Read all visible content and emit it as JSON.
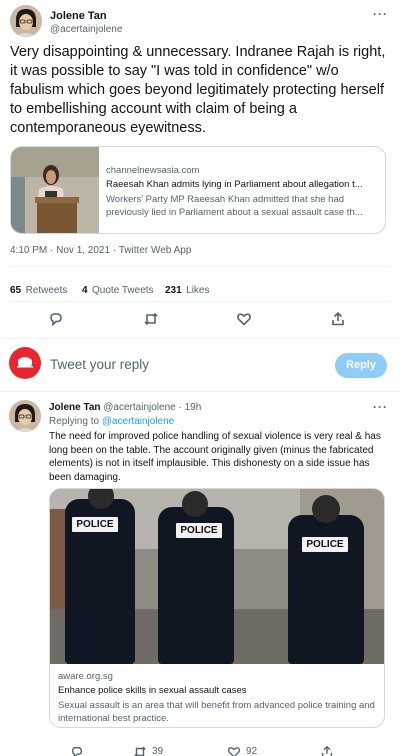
{
  "main_tweet": {
    "author_name": "Jolene Tan",
    "author_handle": "@acertainjolene",
    "more_icon": "more-icon",
    "text": "Very disappointing & unnecessary. Indranee Rajah is right, it was possible to say \"I was told in confidence\" w/o fabulism which goes beyond legitimately protecting herself to embellishing account with claim of being a contemporaneous eyewitness.",
    "card": {
      "domain": "channelnewsasia.com",
      "title": "Raeesah Khan admits lying in Parliament about allegation t...",
      "description": "Workers' Party MP Raeesah Khan admitted that she had previously lied in Parliament about a sexual assault case th..."
    },
    "timestamp": "4:10 PM · Nov 1, 2021 · Twitter Web App",
    "stats": {
      "retweets_count": "65",
      "retweets_label": "Retweets",
      "quotes_count": "4",
      "quotes_label": "Quote Tweets",
      "likes_count": "231",
      "likes_label": "Likes"
    }
  },
  "reply_composer": {
    "placeholder": "Tweet your reply",
    "button_label": "Reply"
  },
  "reply_tweet": {
    "author_name": "Jolene Tan",
    "author_handle": "@acertainjolene",
    "separator": "·",
    "time_ago": "19h",
    "replying_to_prefix": "Replying to",
    "replying_to_handle": "@acertainjolene",
    "text": "The need for improved police handling of sexual violence is very real & has long been on the table. The account originally given (minus the fabricated elements) is not in itself implausible. This dishonesty on a side issue has been damaging.",
    "image_labels": [
      "POLICE",
      "POLICE",
      "POLICE"
    ],
    "card": {
      "domain": "aware.org.sg",
      "title": "Enhance police skills in sexual assault cases",
      "description": "Sexual assault is an area that will benefit from advanced police training and international best practice."
    },
    "actions": {
      "retweet_count": "39",
      "like_count": "92"
    }
  },
  "colors": {
    "accent": "#1d9bf0",
    "text_primary": "#0f1419",
    "text_secondary": "#536471",
    "border": "#cfd9de",
    "reply_button_disabled": "#8ecdf8",
    "composer_avatar": "#e8262f"
  }
}
